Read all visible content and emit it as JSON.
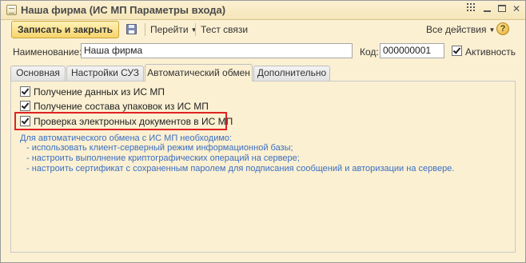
{
  "window": {
    "title": "Наша фирма (ИС МП Параметры входа)"
  },
  "toolbar": {
    "save_close_label": "Записать и закрыть",
    "goto_label": "Перейти",
    "test_label": "Тест связи",
    "all_actions_label": "Все действия",
    "help_label": "?"
  },
  "form": {
    "name_label": "Наименование:",
    "name_value": "Наша фирма",
    "code_label": "Код:",
    "code_value": "000000001",
    "active_label": "Активность",
    "active_checked": true
  },
  "tabs": [
    {
      "label": "Основная"
    },
    {
      "label": "Настройки СУЗ"
    },
    {
      "label": "Автоматический обмен"
    },
    {
      "label": "Дополнительно"
    }
  ],
  "auto_exchange": {
    "options": [
      {
        "label": "Получение данных из ИС МП",
        "checked": true
      },
      {
        "label": "Получение состава упаковок из ИС МП",
        "checked": true
      },
      {
        "label": "Проверка электронных документов в ИС МП",
        "checked": true
      }
    ],
    "info_lines": [
      "Для автоматического обмена с ИС МП необходимо:",
      "- использовать клиент-серверный режим информационной базы;",
      "- настроить выполнение криптографических операций на сервере;",
      "- настроить сертификат с сохраненным паролем для подписания сообщений и авторизации на сервере."
    ]
  },
  "colors": {
    "window_bg": "#fbf0d2",
    "primary_button": "#f7d46a",
    "info_text": "#3a6fc4",
    "highlight_border": "#e02222"
  }
}
